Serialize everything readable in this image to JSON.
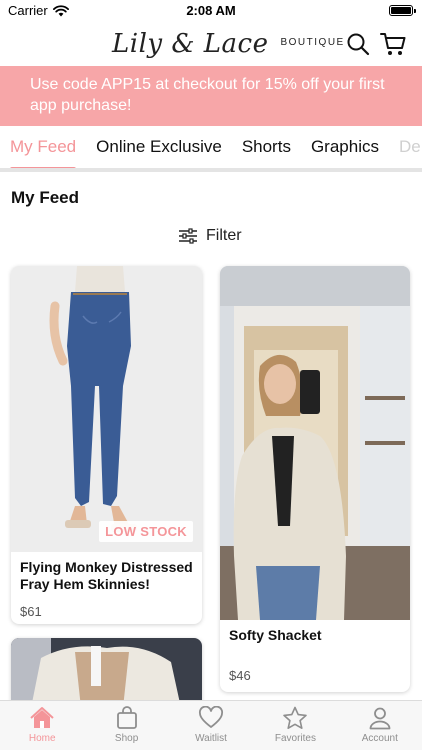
{
  "status_bar": {
    "carrier": "Carrier",
    "time": "2:08 AM"
  },
  "header": {
    "logo_script": "Lily & Lace",
    "logo_badge": "BOUTIQUE"
  },
  "promo_banner": {
    "text": "Use code APP15 at checkout for 15% off your first app purchase!"
  },
  "tabs": [
    {
      "label": "My Feed"
    },
    {
      "label": "Online Exclusive"
    },
    {
      "label": "Shorts"
    },
    {
      "label": "Graphics"
    },
    {
      "label": "De"
    }
  ],
  "main": {
    "section_title": "My Feed",
    "filter_label": "Filter"
  },
  "products": [
    {
      "name": "Flying Monkey Distressed Fray Hem Skinnies!",
      "price": "$61",
      "badge": "LOW STOCK"
    },
    {
      "name": "Softy Shacket",
      "price": "$46"
    }
  ],
  "tabbar": [
    {
      "label": "Home",
      "icon": "home-icon"
    },
    {
      "label": "Shop",
      "icon": "shopping-bag-icon"
    },
    {
      "label": "Waitlist",
      "icon": "heart-icon"
    },
    {
      "label": "Favorites",
      "icon": "star-icon"
    },
    {
      "label": "Account",
      "icon": "user-icon"
    }
  ],
  "colors": {
    "accent": "#f49599",
    "promo_bg": "#f7a6a8",
    "text": "#111111",
    "tabbar_inactive": "#8e8e8e"
  }
}
